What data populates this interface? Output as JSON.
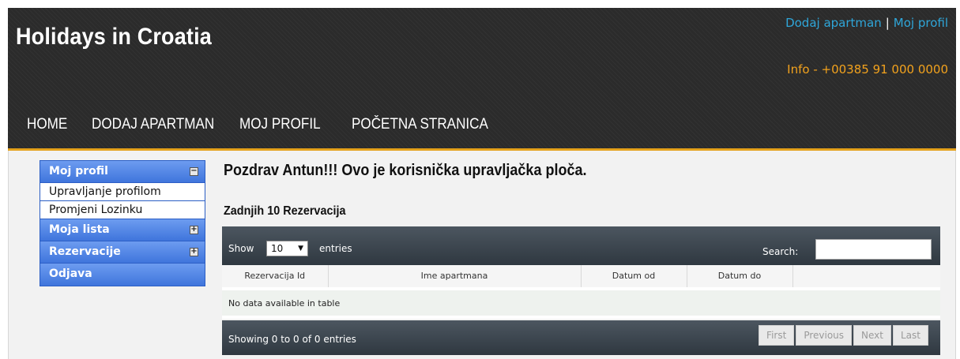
{
  "site": {
    "title": "Holidays in Croatia",
    "top_links": [
      "Dodaj apartman",
      "Moj profil"
    ],
    "top_links_separator": "|",
    "info": "Info - +00385 91 000 0000"
  },
  "nav": [
    "HOME",
    "DODAJ APARTMAN",
    "MOJ PROFIL",
    "POČETNA STRANICA"
  ],
  "sidebar": {
    "sections": [
      {
        "label": "Moj profil",
        "toggle": "−",
        "expanded": true,
        "items": [
          "Upravljanje profilom",
          "Promjeni Lozinku"
        ]
      },
      {
        "label": "Moja lista",
        "toggle": "+",
        "expanded": false
      },
      {
        "label": "Rezervacije",
        "toggle": "+",
        "expanded": false
      },
      {
        "label": "Odjava"
      }
    ]
  },
  "main": {
    "greeting": "Pozdrav Antun!!! Ovo je korisnička upravljačka ploča.",
    "reservations_title": "Zadnjih 10 Rezervacija"
  },
  "table": {
    "show_label": "Show",
    "length_value": "10",
    "entries_label": "entries",
    "search_label": "Search:",
    "search_value": "",
    "columns": [
      "Rezervacija Id",
      "Ime apartmana",
      "Datum od",
      "Datum do",
      ""
    ],
    "empty_text": "No data available in table",
    "info": "Showing 0 to 0 of 0 entries",
    "pager": [
      "First",
      "Previous",
      "Next",
      "Last"
    ]
  },
  "colors": {
    "header_bg": "#2b2b2b",
    "header_accent": "#e4a11b",
    "link_blue": "#2fa6d9",
    "info_orange": "#f2a21d",
    "sidebar_blue": "#3f75dc"
  }
}
